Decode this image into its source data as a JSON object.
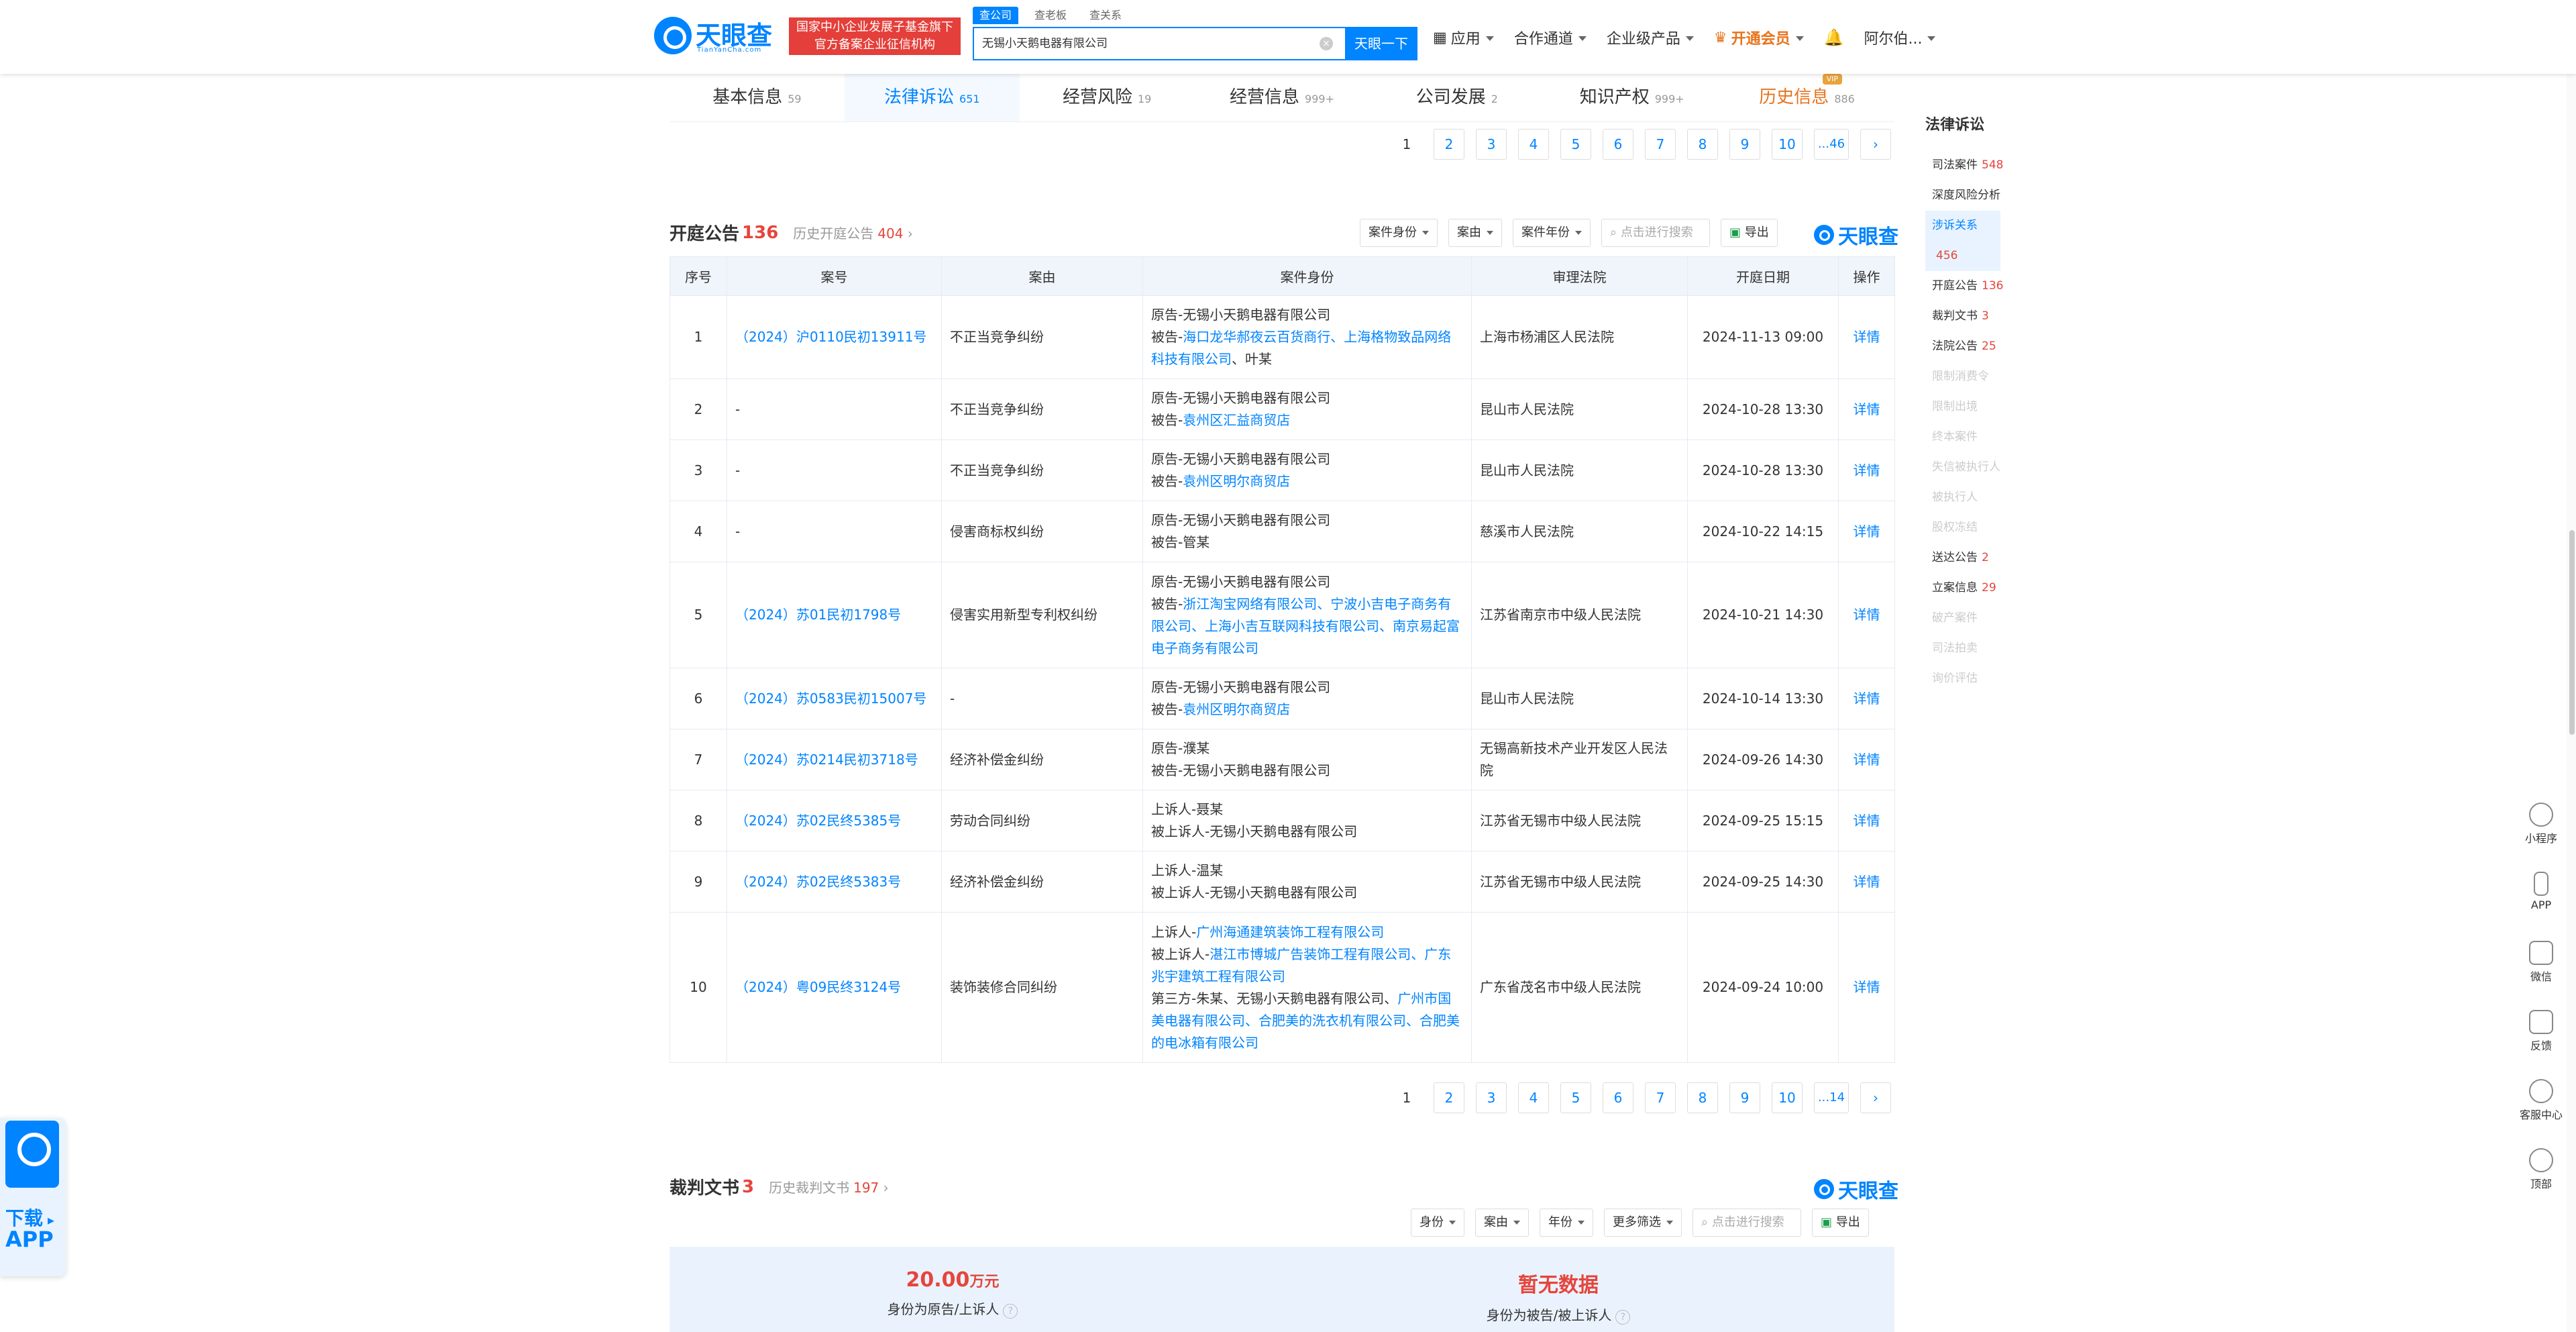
{
  "header": {
    "logo_name": "天眼查",
    "logo_sub": "TianYanCha.com",
    "gov_line1": "国家中小企业发展子基金旗下",
    "gov_line2": "官方备案企业征信机构",
    "search_tabs": [
      "查公司",
      "查老板",
      "查关系"
    ],
    "search_value": "无锡小天鹅电器有限公司",
    "search_button": "天眼一下",
    "nav": [
      "应用",
      "合作通道",
      "企业级产品",
      "开通会员"
    ],
    "user": "阿尔伯..."
  },
  "tabs": [
    {
      "label": "基本信息",
      "count": "59"
    },
    {
      "label": "法律诉讼",
      "count": "651"
    },
    {
      "label": "经营风险",
      "count": "19"
    },
    {
      "label": "经营信息",
      "count": "999+"
    },
    {
      "label": "公司发展",
      "count": "2"
    },
    {
      "label": "知识产权",
      "count": "999+"
    },
    {
      "label": "历史信息",
      "count": "886",
      "badge": "VIP"
    }
  ],
  "pager_top": [
    "1",
    "2",
    "3",
    "4",
    "5",
    "6",
    "7",
    "8",
    "9",
    "10",
    "...46",
    "›"
  ],
  "hearing": {
    "title": "开庭公告",
    "count": "136",
    "history_label": "历史开庭公告",
    "history_count": "404",
    "filters": [
      "案件身份",
      "案由",
      "案件年份"
    ],
    "search_placeholder": "点击进行搜索",
    "export": "导出",
    "brand": "天眼查",
    "columns": [
      "序号",
      "案号",
      "案由",
      "案件身份",
      "审理法院",
      "开庭日期",
      "操作"
    ],
    "rows": [
      {
        "no": "1",
        "case_no": "（2024）沪0110民初13911号",
        "cause": "不正当竞争纠纷",
        "parties": [
          {
            "p": "原告-",
            "v": "无锡小天鹅电器有限公司",
            "link": false
          },
          {
            "p": "被告-",
            "v": "海口龙华郝夜云百货商行、上海格物致品网络科技有限公司",
            "link": true,
            "tail": "、叶某"
          }
        ],
        "court": "上海市杨浦区人民法院",
        "date": "2024-11-13 09:00",
        "op": "详情"
      },
      {
        "no": "2",
        "case_no": "-",
        "cause": "不正当竞争纠纷",
        "parties": [
          {
            "p": "原告-",
            "v": "无锡小天鹅电器有限公司",
            "link": false
          },
          {
            "p": "被告-",
            "v": "袁州区汇益商贸店",
            "link": true,
            "tail": ""
          }
        ],
        "court": "昆山市人民法院",
        "date": "2024-10-28 13:30",
        "op": "详情"
      },
      {
        "no": "3",
        "case_no": "-",
        "cause": "不正当竞争纠纷",
        "parties": [
          {
            "p": "原告-",
            "v": "无锡小天鹅电器有限公司",
            "link": false
          },
          {
            "p": "被告-",
            "v": "袁州区明尔商贸店",
            "link": true,
            "tail": ""
          }
        ],
        "court": "昆山市人民法院",
        "date": "2024-10-28 13:30",
        "op": "详情"
      },
      {
        "no": "4",
        "case_no": "-",
        "cause": "侵害商标权纠纷",
        "parties": [
          {
            "p": "原告-",
            "v": "无锡小天鹅电器有限公司",
            "link": false
          },
          {
            "p": "被告-",
            "v": "管某",
            "link": false,
            "tail": ""
          }
        ],
        "court": "慈溪市人民法院",
        "date": "2024-10-22 14:15",
        "op": "详情"
      },
      {
        "no": "5",
        "case_no": "（2024）苏01民初1798号",
        "cause": "侵害实用新型专利权纠纷",
        "parties": [
          {
            "p": "原告-",
            "v": "无锡小天鹅电器有限公司",
            "link": false
          },
          {
            "p": "被告-",
            "v": "浙江淘宝网络有限公司、宁波小吉电子商务有限公司、上海小吉互联网科技有限公司、南京易起富电子商务有限公司",
            "link": true,
            "tail": ""
          }
        ],
        "court": "江苏省南京市中级人民法院",
        "date": "2024-10-21 14:30",
        "op": "详情"
      },
      {
        "no": "6",
        "case_no": "（2024）苏0583民初15007号",
        "cause": "-",
        "parties": [
          {
            "p": "原告-",
            "v": "无锡小天鹅电器有限公司",
            "link": false
          },
          {
            "p": "被告-",
            "v": "袁州区明尔商贸店",
            "link": true,
            "tail": ""
          }
        ],
        "court": "昆山市人民法院",
        "date": "2024-10-14 13:30",
        "op": "详情"
      },
      {
        "no": "7",
        "case_no": "（2024）苏0214民初3718号",
        "cause": "经济补偿金纠纷",
        "parties": [
          {
            "p": "原告-",
            "v": "濮某",
            "link": false
          },
          {
            "p": "被告-",
            "v": "无锡小天鹅电器有限公司",
            "link": false,
            "tail": ""
          }
        ],
        "court": "无锡高新技术产业开发区人民法院",
        "date": "2024-09-26 14:30",
        "op": "详情"
      },
      {
        "no": "8",
        "case_no": "（2024）苏02民终5385号",
        "cause": "劳动合同纠纷",
        "parties": [
          {
            "p": "上诉人-",
            "v": "聂某",
            "link": false
          },
          {
            "p": "被上诉人-",
            "v": "无锡小天鹅电器有限公司",
            "link": false,
            "tail": ""
          }
        ],
        "court": "江苏省无锡市中级人民法院",
        "date": "2024-09-25 15:15",
        "op": "详情"
      },
      {
        "no": "9",
        "case_no": "（2024）苏02民终5383号",
        "cause": "经济补偿金纠纷",
        "parties": [
          {
            "p": "上诉人-",
            "v": "温某",
            "link": false
          },
          {
            "p": "被上诉人-",
            "v": "无锡小天鹅电器有限公司",
            "link": false,
            "tail": ""
          }
        ],
        "court": "江苏省无锡市中级人民法院",
        "date": "2024-09-25 14:30",
        "op": "详情"
      },
      {
        "no": "10",
        "case_no": "（2024）粤09民终3124号",
        "cause": "装饰装修合同纠纷",
        "parties": [
          {
            "p": "上诉人-",
            "v": "广州海通建筑装饰工程有限公司",
            "link": true,
            "tail": ""
          },
          {
            "p": "被上诉人-",
            "v": "湛江市博城广告装饰工程有限公司、广东兆宇建筑工程有限公司",
            "link": true,
            "tail": ""
          },
          {
            "p": "第三方-",
            "v": "朱某、无锡小天鹅电器有限公司、",
            "link": false,
            "tail2": "广州市国美电器有限公司、合肥美的洗衣机有限公司、合肥美的电冰箱有限公司"
          }
        ],
        "court": "广东省茂名市中级人民法院",
        "date": "2024-09-24 10:00",
        "op": "详情"
      }
    ]
  },
  "pager_bottom": [
    "1",
    "2",
    "3",
    "4",
    "5",
    "6",
    "7",
    "8",
    "9",
    "10",
    "...14",
    "›"
  ],
  "judgment": {
    "title": "裁判文书",
    "count": "3",
    "history_label": "历史裁判文书",
    "history_count": "197",
    "filters": [
      "身份",
      "案由",
      "年份",
      "更多筛选"
    ],
    "search_placeholder": "点击进行搜索",
    "export": "导出",
    "brand": "天眼查",
    "summary_left_value": "20.00",
    "summary_left_unit": "万元",
    "summary_left_label": "身份为原告/上诉人",
    "summary_right_value": "暂无数据",
    "summary_right_label": "身份为被告/被上诉人"
  },
  "sidenav": {
    "title": "法律诉讼",
    "items": [
      {
        "label": "司法案件",
        "count": "548",
        "state": ""
      },
      {
        "label": "深度风险分析",
        "count": "",
        "state": ""
      },
      {
        "label": "涉诉关系",
        "count": "456",
        "state": "on"
      },
      {
        "label": "开庭公告",
        "count": "136",
        "state": ""
      },
      {
        "label": "裁判文书",
        "count": "3",
        "state": ""
      },
      {
        "label": "法院公告",
        "count": "25",
        "state": ""
      },
      {
        "label": "限制消费令",
        "count": "",
        "state": "dis"
      },
      {
        "label": "限制出境",
        "count": "",
        "state": "dis"
      },
      {
        "label": "终本案件",
        "count": "",
        "state": "dis"
      },
      {
        "label": "失信被执行人",
        "count": "",
        "state": "dis"
      },
      {
        "label": "被执行人",
        "count": "",
        "state": "dis"
      },
      {
        "label": "股权冻结",
        "count": "",
        "state": "dis"
      },
      {
        "label": "送达公告",
        "count": "2",
        "state": ""
      },
      {
        "label": "立案信息",
        "count": "29",
        "state": ""
      },
      {
        "label": "破产案件",
        "count": "",
        "state": "dis"
      },
      {
        "label": "司法拍卖",
        "count": "",
        "state": "dis"
      },
      {
        "label": "询价评估",
        "count": "",
        "state": "dis"
      }
    ]
  },
  "tools": [
    "小程序",
    "APP",
    "微信",
    "反馈",
    "客服中心",
    "顶部"
  ],
  "app_download": {
    "line1": "下载",
    "line2": "APP"
  }
}
